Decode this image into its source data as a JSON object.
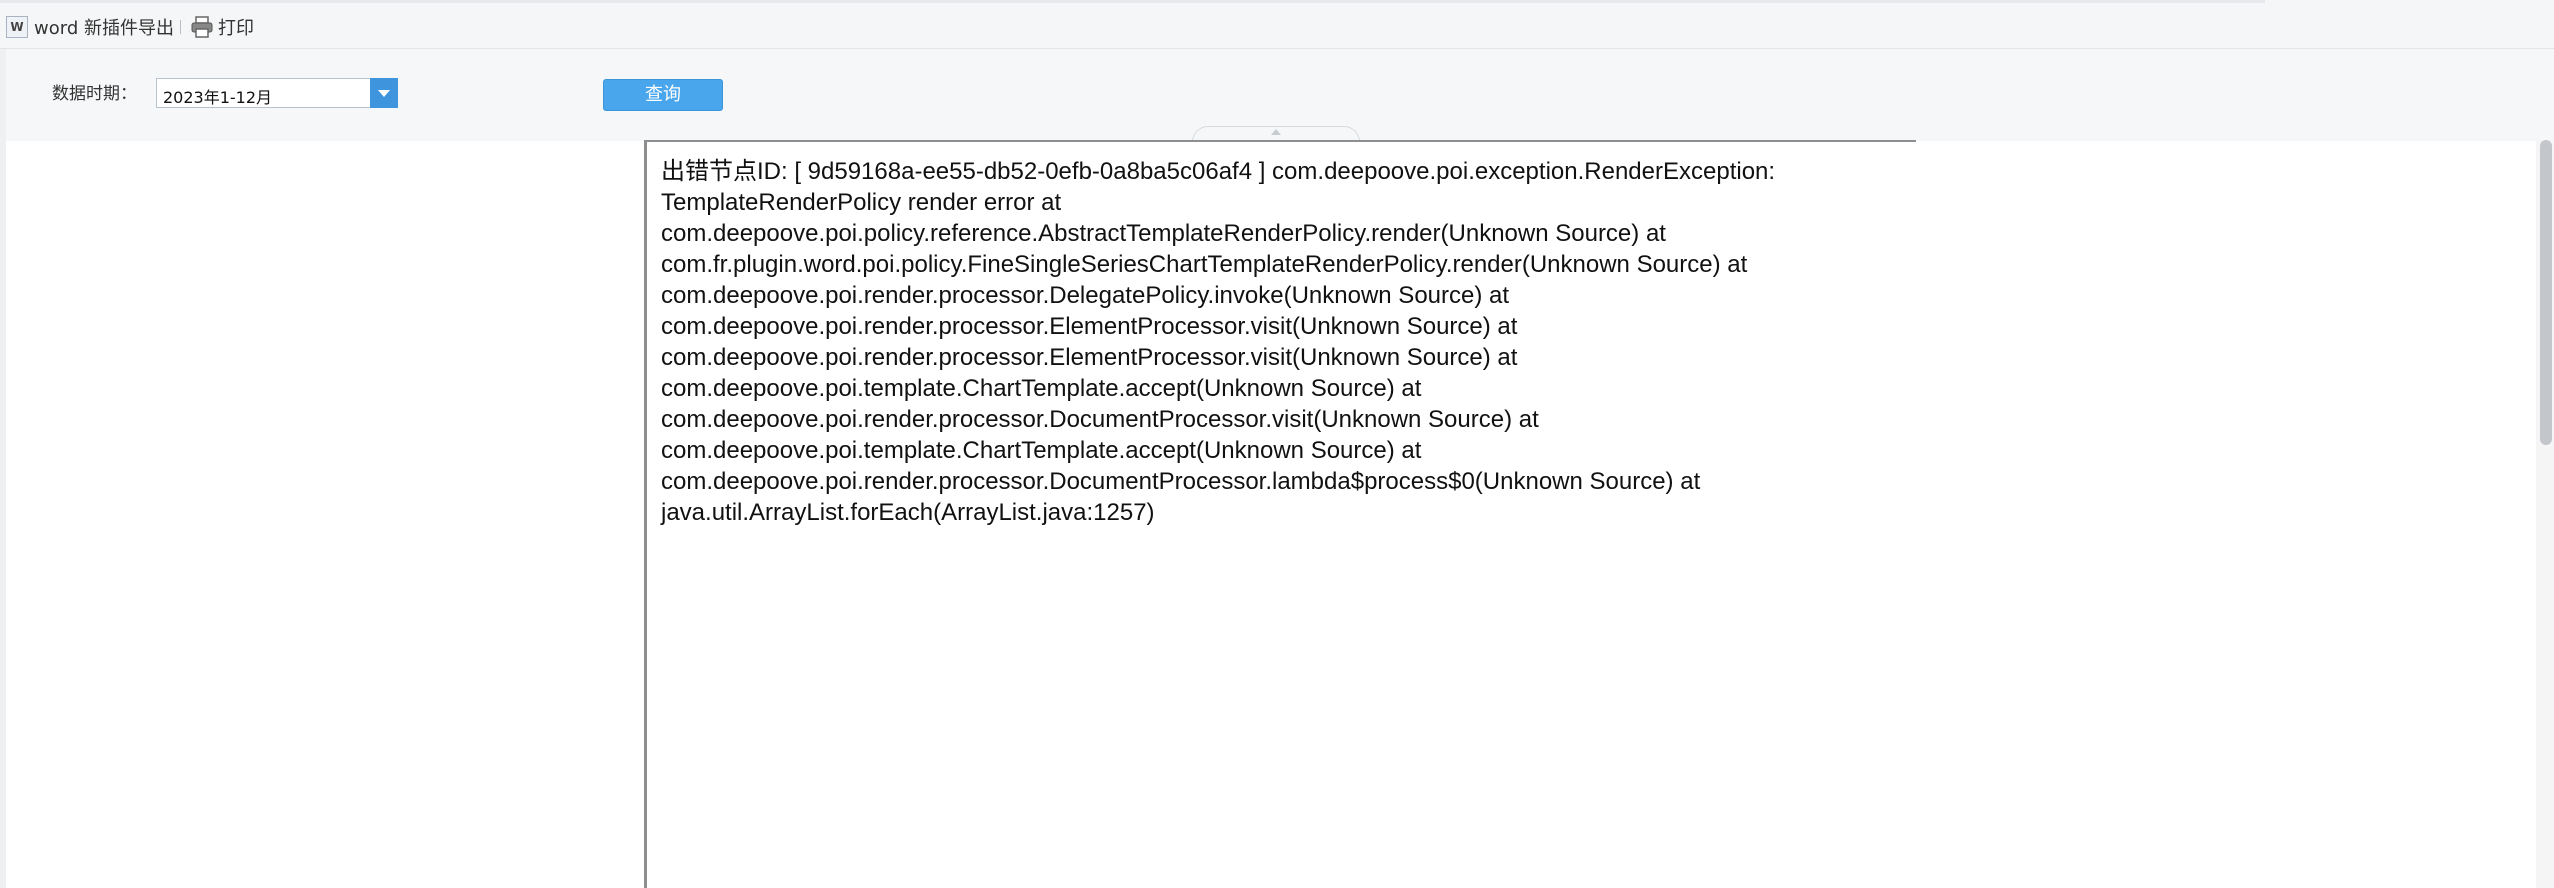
{
  "toolbar": {
    "word_export_label": "word 新插件导出",
    "word_icon_text": "W",
    "print_label": "打印"
  },
  "params": {
    "date_label": "数据时期：",
    "date_value": "2023年1-12月",
    "query_label": "查询"
  },
  "report": {
    "error_lines": [
      "出错节点ID: [ 9d59168a-ee55-db52-0efb-0a8ba5c06af4 ] com.deepoove.poi.exception.RenderException:",
      "TemplateRenderPolicy render error at",
      "com.deepoove.poi.policy.reference.AbstractTemplateRenderPolicy.render(Unknown Source) at",
      "com.fr.plugin.word.poi.policy.FineSingleSeriesChartTemplateRenderPolicy.render(Unknown Source) at",
      "com.deepoove.poi.render.processor.DelegatePolicy.invoke(Unknown Source) at",
      "com.deepoove.poi.render.processor.ElementProcessor.visit(Unknown Source) at",
      "com.deepoove.poi.render.processor.ElementProcessor.visit(Unknown Source) at",
      "com.deepoove.poi.template.ChartTemplate.accept(Unknown Source) at",
      "com.deepoove.poi.render.processor.DocumentProcessor.visit(Unknown Source) at",
      "com.deepoove.poi.template.ChartTemplate.accept(Unknown Source) at",
      "com.deepoove.poi.render.processor.DocumentProcessor.lambda$process$0(Unknown Source) at",
      "java.util.ArrayList.forEach(ArrayList.java:1257)"
    ]
  },
  "colors": {
    "accent": "#4aa6ec",
    "combo_button": "#3e95dd"
  },
  "icons": {
    "word_export": "word-icon",
    "print": "printer-icon",
    "dropdown": "chevron-down-icon",
    "collapse": "chevron-up-icon"
  }
}
